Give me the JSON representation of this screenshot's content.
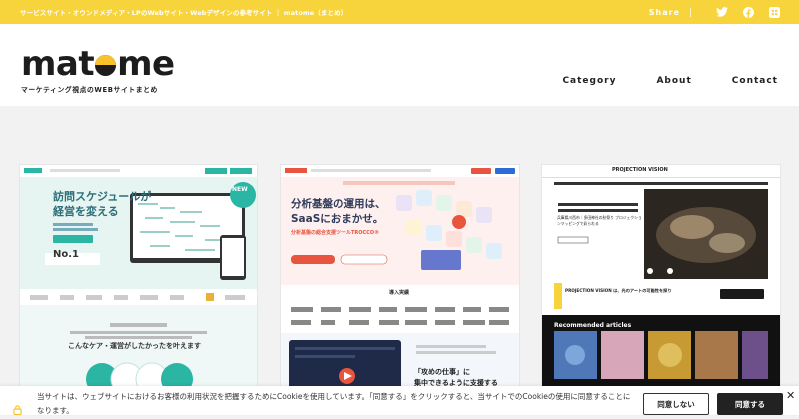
{
  "topbar": {
    "tagline": "サービスサイト・オウンドメディア・LPのWebサイト・Webデザインの参考サイト ｜ matome（まとめ）",
    "share_label": "Share",
    "icons": [
      "twitter-icon",
      "facebook-icon",
      "feedly-icon"
    ]
  },
  "logo": {
    "text_before": "mat",
    "text_after": "me",
    "subtitle": "マーケティング視点のWEBサイトまとめ"
  },
  "nav": {
    "items": [
      "Category",
      "About",
      "Contact"
    ]
  },
  "cards": [
    {
      "headline": "訪問スケジュールが\n経営を変える",
      "badge": "NEW",
      "rank": "No.1",
      "tagline": "こんなケア・運営がしたかったを叶えます"
    },
    {
      "headline": "分析基盤の運用は、\nSaaSにおまかせ。",
      "subline": "分析基盤の総合支援ツールTROCCO®",
      "section": "導入実績",
      "bottom_text": "「攻めの仕事」に\n集中できるように支援する"
    },
    {
      "logo": "PROJECTION VISION",
      "news_title": "兵庫県川西市｜多田神社の秋祭り プロジェクションマッピングで彩られる",
      "banner": "PROJECTION VISION は、光のアートの可能性を探り",
      "recommended": "Recommended articles"
    }
  ],
  "cookie": {
    "message": "当サイトは、ウェブサイトにおけるお客様の利用状況を把握するためにCookieを使用しています。「同意する」をクリックすると、当サイトでのCookieの使用に同意することになります。",
    "deny_label": "同意しない",
    "agree_label": "同意する",
    "close_label": "✕"
  },
  "colors": {
    "accent": "#f7d33c",
    "logo_dot_top": "#f7c22c",
    "dark": "#222222"
  }
}
